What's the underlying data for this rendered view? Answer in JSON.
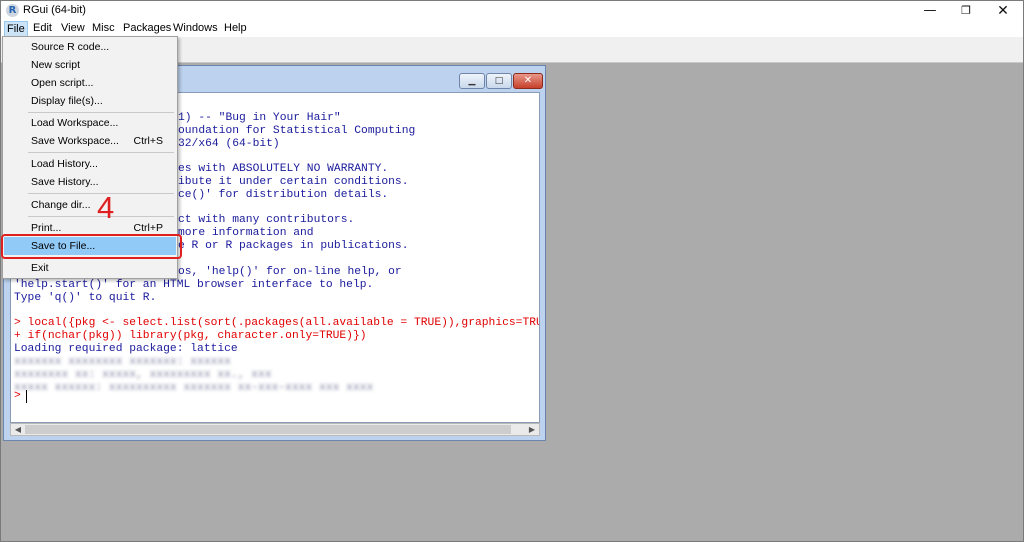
{
  "app": {
    "title": "RGui (64-bit)",
    "icon": "r-logo-icon"
  },
  "window_controls": {
    "minimize": "—",
    "restore": "❐",
    "close": "✕"
  },
  "menubar": {
    "file": "File",
    "edit": "Edit",
    "view": "View",
    "misc": "Misc",
    "packages": "Packages",
    "windows": "Windows",
    "help": "Help"
  },
  "file_menu": {
    "source_r_code": "Source R code...",
    "new_script": "New script",
    "open_script": "Open script...",
    "display_files": "Display file(s)...",
    "load_workspace": "Load Workspace...",
    "save_workspace": "Save Workspace...",
    "save_workspace_shortcut": "Ctrl+S",
    "load_history": "Load History...",
    "save_history": "Save History...",
    "change_dir": "Change dir...",
    "print": "Print...",
    "print_shortcut": "Ctrl+P",
    "save_to_file": "Save to File...",
    "exit": "Exit"
  },
  "annotation": {
    "step_number": "4",
    "color": "#e02020"
  },
  "console": {
    "lines": [
      "1) -- \"Bug in Your Hair\"",
      "oundation for Statistical Computing",
      "32/x64 (64-bit)",
      "es with ABSOLUTELY NO WARRANTY.",
      "ibute it under certain conditions.",
      "ce()' for distribution details.",
      "ct with many contributors.",
      "more information and",
      "e R or R packages in publications.",
      "os, 'help()' for on-line help, or",
      "'help.start()' for an HTML browser interface to help.",
      "Type 'q()' to quit R.",
      "> local({pkg <- select.list(sort(.packages(all.available = TRUE)),graphics=TRUE)",
      "+ if(nchar(pkg)) library(pkg, character.only=TRUE)})",
      "Loading required package: lattice",
      ">"
    ],
    "output_color": "#1a1a9c",
    "input_color": "#e00000"
  }
}
